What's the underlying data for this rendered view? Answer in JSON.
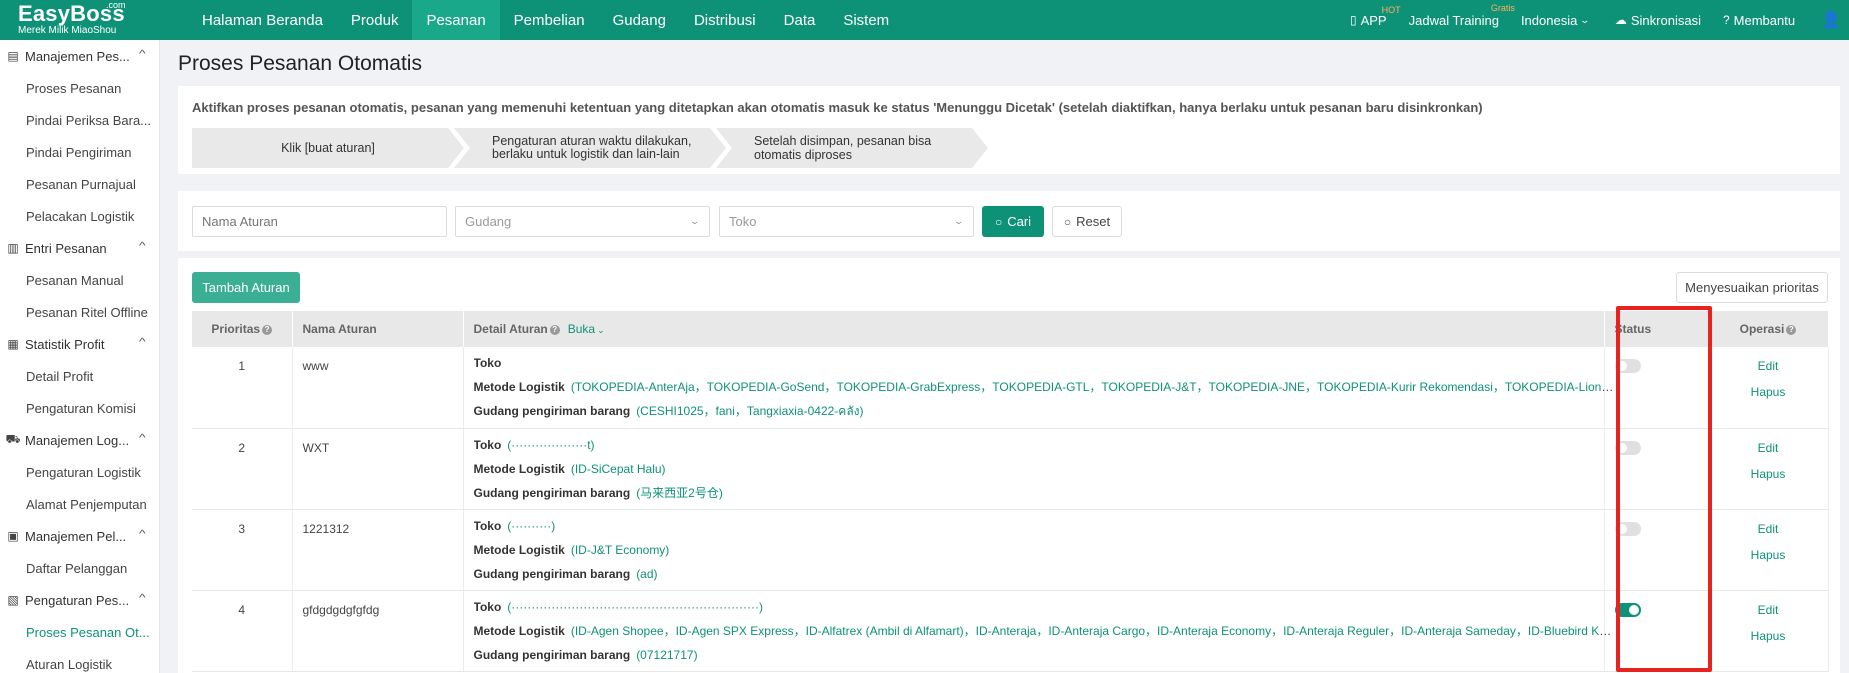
{
  "brand": {
    "name": "EasyBoss",
    "com": ".com",
    "tagline": "Merek Milik MiaoShou"
  },
  "nav": [
    {
      "label": "Halaman Beranda"
    },
    {
      "label": "Produk"
    },
    {
      "label": "Pesanan"
    },
    {
      "label": "Pembelian"
    },
    {
      "label": "Gudang"
    },
    {
      "label": "Distribusi"
    },
    {
      "label": "Data"
    },
    {
      "label": "Sistem"
    }
  ],
  "top_right": {
    "app": "APP",
    "app_badge": "HOT",
    "training": "Jadwal Training",
    "training_badge": "Gratis",
    "language": "Indonesia",
    "sync": "Sinkronisasi",
    "help": "Membantu"
  },
  "sidebar": [
    {
      "group": "Manajemen Pes...",
      "items": [
        "Proses Pesanan",
        "Pindai Periksa Bara...",
        "Pindai Pengiriman",
        "Pesanan Purnajual",
        "Pelacakan Logistik"
      ]
    },
    {
      "group": "Entri Pesanan",
      "items": [
        "Pesanan Manual",
        "Pesanan Ritel Offline"
      ]
    },
    {
      "group": "Statistik Profit",
      "items": [
        "Detail Profit",
        "Pengaturan Komisi"
      ]
    },
    {
      "group": "Manajemen Log...",
      "items": [
        "Pengaturan Logistik",
        "Alamat Penjemputan"
      ]
    },
    {
      "group": "Manajemen Pel...",
      "items": [
        "Daftar Pelanggan"
      ]
    },
    {
      "group": "Pengaturan Pes...",
      "items": [
        "Proses Pesanan Ot...",
        "Aturan Logistik"
      ]
    }
  ],
  "page": {
    "title": "Proses Pesanan Otomatis",
    "info": "Aktifkan proses pesanan otomatis, pesanan yang memenuhi ketentuan yang ditetapkan akan otomatis masuk ke status 'Menunggu Dicetak' (setelah diaktifkan, hanya berlaku untuk pesanan baru disinkronkan)",
    "steps": [
      "Klik [buat aturan]",
      "Pengaturan aturan waktu dilakukan, berlaku untuk logistik dan lain-lain",
      "Setelah disimpan, pesanan bisa otomatis diproses"
    ]
  },
  "filter": {
    "rule_name_placeholder": "Nama Aturan",
    "warehouse_placeholder": "Gudang",
    "shop_placeholder": "Toko",
    "search_label": "Cari",
    "reset_label": "Reset"
  },
  "toolbar": {
    "add_label": "Tambah Aturan",
    "priority_label": "Menyesuaikan prioritas"
  },
  "table": {
    "headers": {
      "priority": "Prioritas",
      "name": "Nama Aturan",
      "detail": "Detail Aturan",
      "expand": "Buka",
      "status": "Status",
      "ops": "Operasi"
    },
    "labels": {
      "shop": "Toko",
      "logistics": "Metode Logistik",
      "warehouse": "Gudang pengiriman barang",
      "edit": "Edit",
      "delete": "Hapus"
    },
    "rows": [
      {
        "priority": "1",
        "name": "www",
        "shop": "",
        "logistics": "(TOKOPEDIA-AnterAja，TOKOPEDIA-GoSend，TOKOPEDIA-GrabExpress，TOKOPEDIA-GTL，TOKOPEDIA-J&T，TOKOPEDIA-JNE，TOKOPEDIA-Kurir Rekomendasi，TOKOPEDIA-Lion Parcel，TOK...",
        "warehouse": "(CESHI1025，fani，Tangxiaxia-0422-คลัง)",
        "status_on": false
      },
      {
        "priority": "2",
        "name": "WXT",
        "shop": "(···················t)",
        "logistics": "(ID-SiCepat Halu)",
        "warehouse": "(马来西亚2号仓)",
        "status_on": false
      },
      {
        "priority": "3",
        "name": "1221312",
        "shop": "(··········)",
        "logistics": "(ID-J&T Economy)",
        "warehouse": "(ad)",
        "status_on": false
      },
      {
        "priority": "4",
        "name": "gfdgdgdgfgfdg",
        "shop": "(······························································)",
        "logistics": "(ID-Agen Shopee，ID-Agen SPX Express，ID-Alfatrex (Ambil di Alfamart)，ID-Anteraja，ID-Anteraja Cargo，ID-Anteraja Economy，ID-Anteraja Reguler，ID-Anteraja Sameday，ID-Bluebird Kirim...",
        "warehouse": "(07121717)",
        "status_on": true
      }
    ]
  },
  "colors": {
    "brand": "#0e9277",
    "highlight": "#e8221f"
  }
}
